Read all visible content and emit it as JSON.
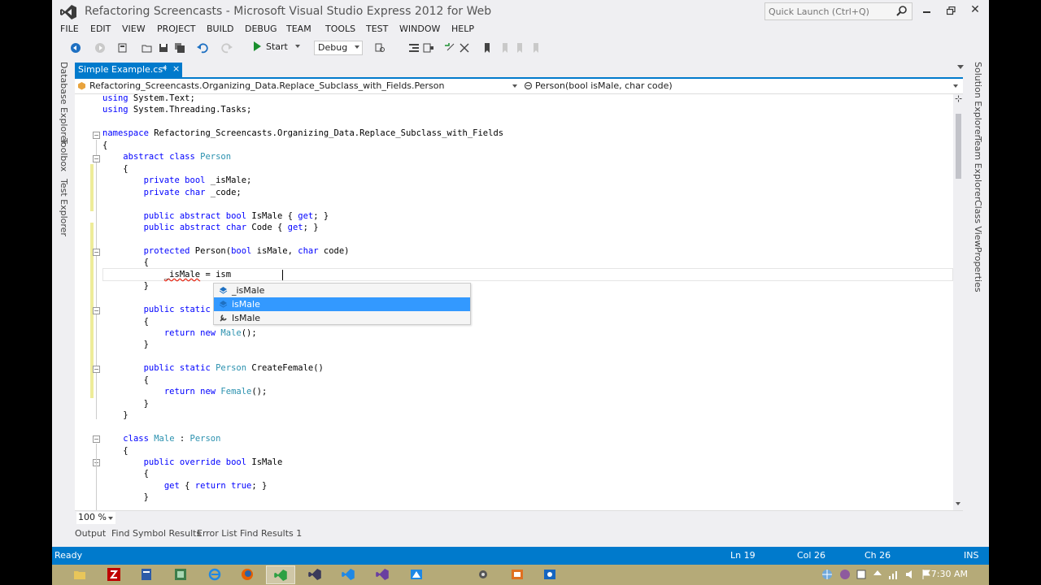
{
  "window": {
    "title": "Refactoring Screencasts - Microsoft Visual Studio Express 2012 for Web",
    "quick_launch_placeholder": "Quick Launch (Ctrl+Q)"
  },
  "menu": [
    "FILE",
    "EDIT",
    "VIEW",
    "PROJECT",
    "BUILD",
    "DEBUG",
    "TEAM",
    "TOOLS",
    "TEST",
    "WINDOW",
    "HELP"
  ],
  "toolbar": {
    "start_label": "Start",
    "configuration": "Debug"
  },
  "left_side_tabs": [
    "Database Explorer",
    "Toolbox",
    "Test Explorer"
  ],
  "right_side_tabs": [
    "Solution Explorer",
    "Team Explorer",
    "Class View",
    "Properties"
  ],
  "document_tab": {
    "label": "Simple Example.cs*",
    "pin": "⊣",
    "close": "×"
  },
  "nav": {
    "type_scope": "Refactoring_Screencasts.Organizing_Data.Replace_Subclass_with_Fields.Person",
    "member_scope": "Person(bool isMale, char code)"
  },
  "code_lines": [
    "using System.Text;",
    "using System.Threading.Tasks;",
    "",
    "namespace Refactoring_Screencasts.Organizing_Data.Replace_Subclass_with_Fields",
    "{",
    "    abstract class Person",
    "    {",
    "        private bool _isMale;",
    "        private char _code;",
    "",
    "        public abstract bool IsMale { get; }",
    "        public abstract char Code { get; }",
    "",
    "        protected Person(bool isMale, char code)",
    "        {",
    "            _isMale = ism",
    "        }",
    "",
    "        public static",
    "        {",
    "            return new Male();",
    "        }",
    "",
    "        public static Person CreateFemale()",
    "        {",
    "            return new Female();",
    "        }",
    "    }",
    "",
    "    class Male : Person",
    "    {",
    "        public override bool IsMale",
    "        {",
    "            get { return true; }",
    "        }"
  ],
  "intellisense": [
    {
      "label": "_isMale",
      "icon": "field-icon",
      "selected": false
    },
    {
      "label": "isMale",
      "icon": "parameter-icon",
      "selected": true
    },
    {
      "label": "IsMale",
      "icon": "property-icon",
      "selected": false
    }
  ],
  "editor": {
    "zoom": "100 %"
  },
  "tool_tabs": [
    "Output",
    "Find Symbol Results",
    "Error List",
    "Find Results 1"
  ],
  "status": {
    "ready": "Ready",
    "ln": "Ln 19",
    "col": "Col 26",
    "ch": "Ch 26",
    "mode": "INS"
  },
  "taskbar": {
    "clock": "7:30 AM"
  },
  "colors": {
    "accent": "#007acc",
    "keyword": "#0000ff",
    "type": "#2b91af",
    "selection": "#3399ff"
  }
}
